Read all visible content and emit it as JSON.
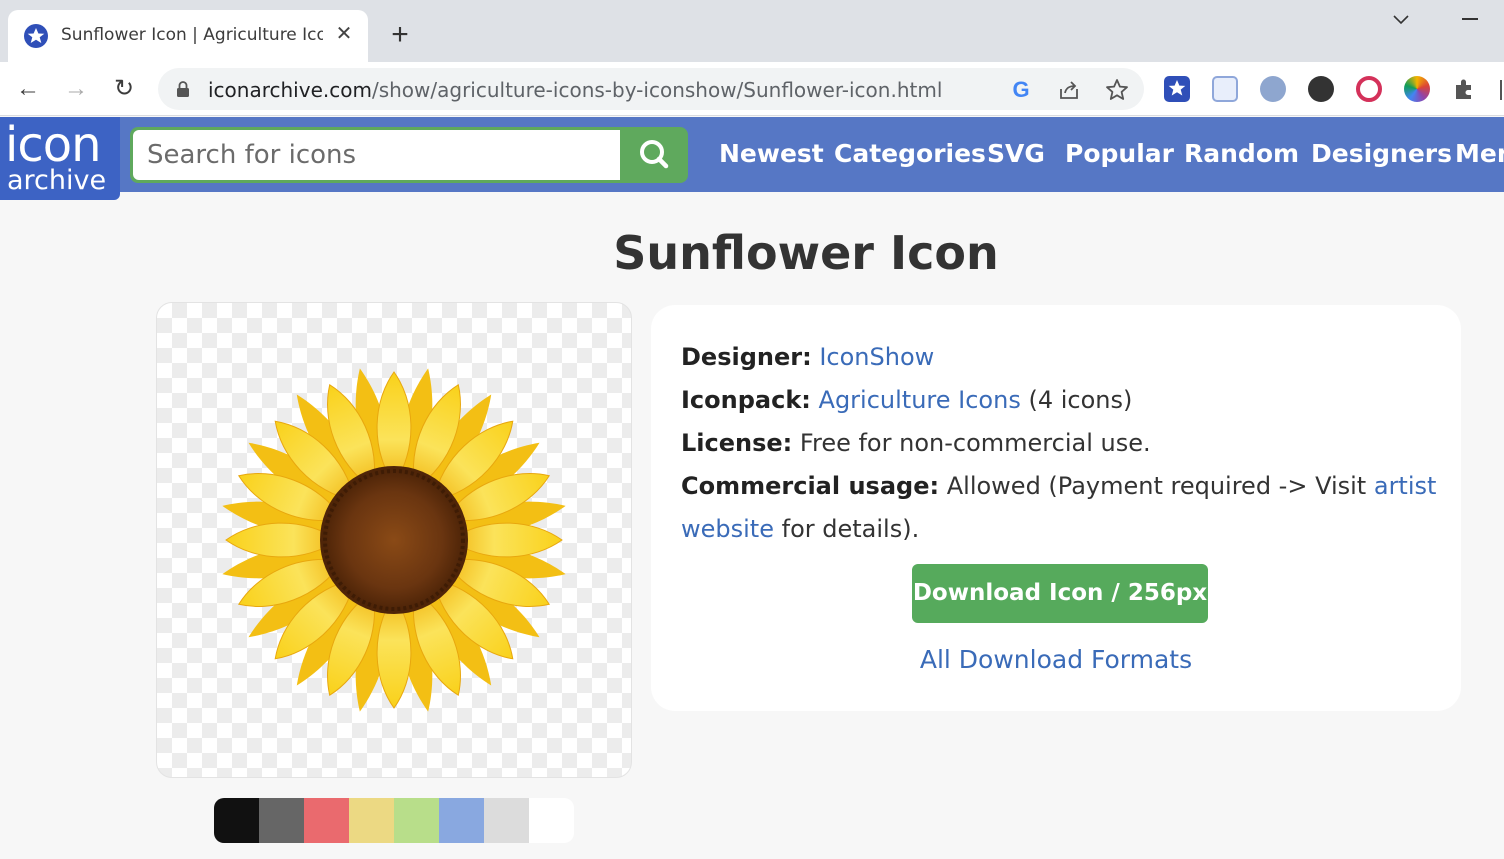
{
  "browser": {
    "tab_title": "Sunflower Icon | Agriculture Icons",
    "new_tab_label": "+",
    "close_label": "✕",
    "url_host": "iconarchive.com",
    "url_path": "/show/agriculture-icons-by-iconshow/Sunflower-icon.html",
    "back_label": "←",
    "forward_label": "→",
    "reload_label": "↻"
  },
  "header": {
    "logo_top": "icon",
    "logo_bottom": "archive",
    "search_placeholder": "Search for icons",
    "nav": [
      "Newest",
      "Categories",
      "SVG",
      "Popular",
      "Random",
      "Designers",
      "Men"
    ]
  },
  "main": {
    "title": "Sunflower Icon",
    "designer_label": "Designer:",
    "designer_value": "IconShow",
    "iconpack_label": "Iconpack:",
    "iconpack_value": "Agriculture Icons",
    "iconpack_count": "(4 icons)",
    "license_label": "License:",
    "license_value": "Free for non-commercial use.",
    "commercial_label": "Commercial usage:",
    "commercial_value_1": "Allowed (Payment required -> Visit",
    "commercial_link_1": "artist",
    "commercial_link_2": "website",
    "commercial_value_2": "for details).",
    "download_button": "Download Icon / 256px",
    "all_formats": "All Download Formats"
  },
  "swatches": [
    {
      "name": "black",
      "color": "#111111"
    },
    {
      "name": "gray",
      "color": "#666666"
    },
    {
      "name": "red",
      "color": "#ea6a6e"
    },
    {
      "name": "yellow",
      "color": "#ecd983"
    },
    {
      "name": "green",
      "color": "#b8de8a"
    },
    {
      "name": "blue",
      "color": "#89a8e0"
    },
    {
      "name": "light-gray",
      "color": "#dcdcdc"
    },
    {
      "name": "white",
      "color": "#ffffff"
    }
  ]
}
